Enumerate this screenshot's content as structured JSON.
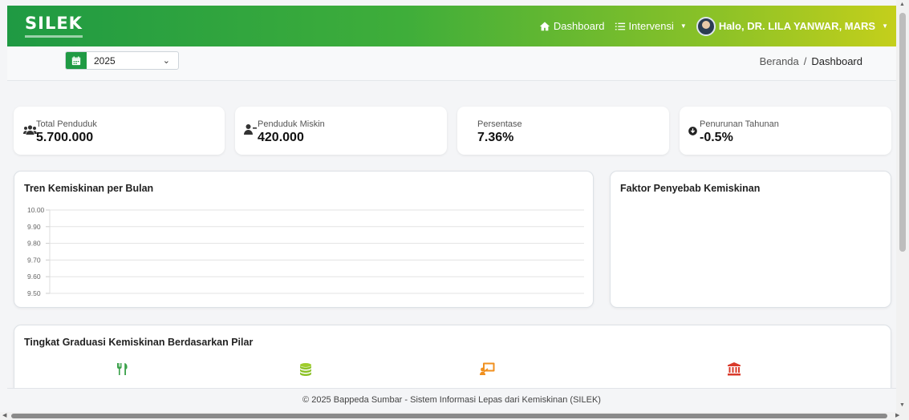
{
  "navbar": {
    "brand": "SILEK",
    "dashboard_label": "Dashboard",
    "intervensi_label": "Intervensi",
    "user_greeting": "Halo, DR. LILA YANWAR, MARS",
    "gradient": [
      "#1f9a43",
      "#c4cf1b"
    ]
  },
  "filter": {
    "year": "2025"
  },
  "breadcrumb": {
    "home": "Beranda",
    "separator": "/",
    "current": "Dashboard"
  },
  "stats": [
    {
      "label": "Total Penduduk",
      "value": "5.700.000",
      "icon": "users-icon"
    },
    {
      "label": "Penduduk Miskin",
      "value": "420.000",
      "icon": "user-minus-icon"
    },
    {
      "label": "Persentase",
      "value": "7.36%",
      "icon": ""
    },
    {
      "label": "Penurunan Tahunan",
      "value": "-0.5%",
      "icon": "arrow-down-circle-icon"
    }
  ],
  "trend_panel": {
    "title": "Tren Kemiskinan per Bulan"
  },
  "chart_data": {
    "type": "line",
    "title": "Tren Kemiskinan per Bulan",
    "ylim": [
      9.5,
      10.0
    ],
    "yticks": [
      "10.00",
      "9.90",
      "9.80",
      "9.70",
      "9.60",
      "9.50"
    ],
    "series": [],
    "grid": true
  },
  "factor_panel": {
    "title": "Faktor Penyebab Kemiskinan"
  },
  "graduation_panel": {
    "title": "Tingkat Graduasi Kemiskinan Berdasarkan Pilar",
    "pillars": [
      {
        "icon": "utensils-icon",
        "color": "#3aa14a"
      },
      {
        "icon": "coins-icon",
        "color": "#8cc227"
      },
      {
        "icon": "teacher-icon",
        "color": "#f0901f"
      },
      {
        "icon": "institution-icon",
        "color": "#d93a2b"
      }
    ]
  },
  "footer": {
    "text": "© 2025 Bappeda Sumbar - Sistem Informasi Lepas dari Kemiskinan (SILEK)"
  }
}
